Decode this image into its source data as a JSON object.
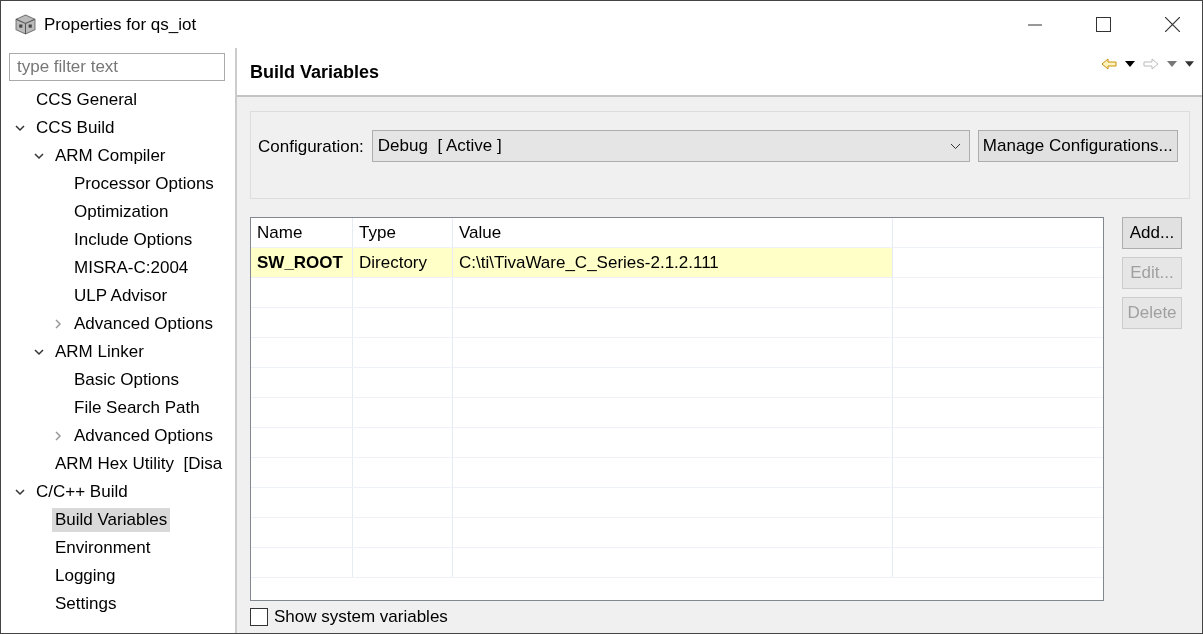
{
  "window": {
    "title": "Properties for qs_iot"
  },
  "filter": {
    "placeholder": "type filter text"
  },
  "tree": [
    {
      "label": "CCS General"
    },
    {
      "label": "CCS Build",
      "expanded": true,
      "children": [
        {
          "label": "ARM Compiler",
          "expanded": true,
          "children": [
            {
              "label": "Processor Options"
            },
            {
              "label": "Optimization"
            },
            {
              "label": "Include Options"
            },
            {
              "label": "MISRA-C:2004"
            },
            {
              "label": "ULP Advisor"
            },
            {
              "label": "Advanced Options",
              "expanded": false
            }
          ]
        },
        {
          "label": "ARM Linker",
          "expanded": true,
          "children": [
            {
              "label": "Basic Options"
            },
            {
              "label": "File Search Path"
            },
            {
              "label": "Advanced Options",
              "expanded": false
            }
          ]
        },
        {
          "label": "ARM Hex Utility  [Disa"
        }
      ]
    },
    {
      "label": "C/C++ Build",
      "expanded": true,
      "children": [
        {
          "label": "Build Variables",
          "selected": true
        },
        {
          "label": "Environment",
          "selected": false
        },
        {
          "label": "Logging",
          "selected": false
        },
        {
          "label": "Settings",
          "selected": false
        }
      ]
    }
  ],
  "page": {
    "title": "Build Variables"
  },
  "configuration": {
    "label": "Configuration:",
    "value": "Debug  [ Active ]",
    "manage_button": "Manage Configurations..."
  },
  "table": {
    "columns": [
      "Name",
      "Type",
      "Value"
    ],
    "rows": [
      {
        "name": "SW_ROOT",
        "type": "Directory",
        "value": "C:\\ti\\TivaWare_C_Series-2.1.2.111"
      }
    ]
  },
  "buttons": [
    {
      "label": "Add...",
      "disabled": false
    },
    {
      "label": "Edit...",
      "disabled": true
    },
    {
      "label": "Delete",
      "disabled": true
    }
  ],
  "show_system": {
    "label": "Show system variables",
    "checked": false
  }
}
